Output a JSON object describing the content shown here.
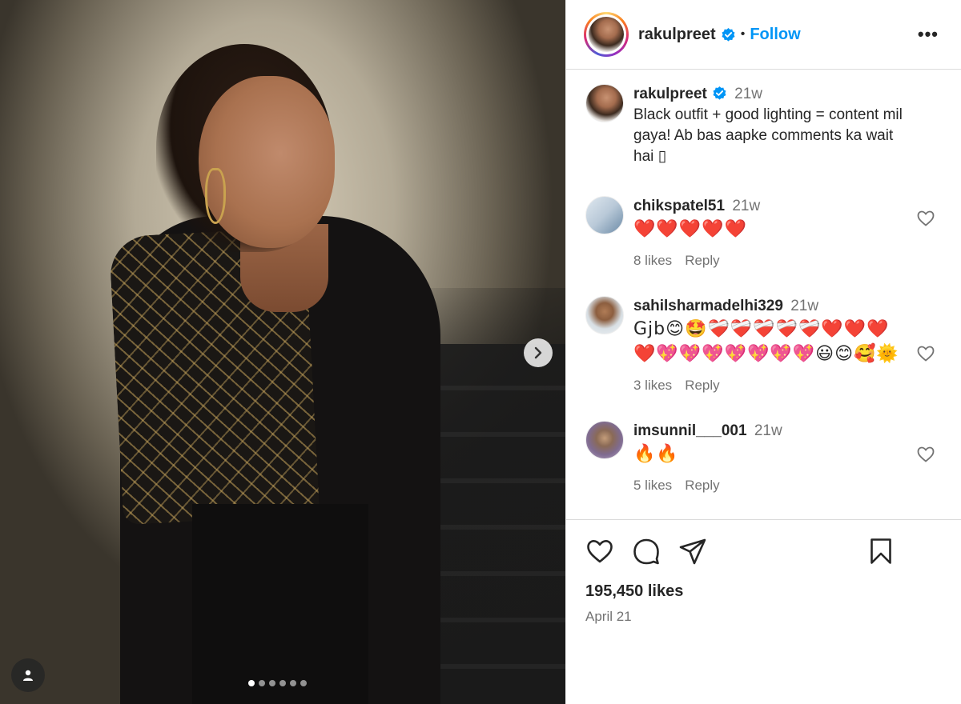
{
  "post": {
    "author": "rakulpreet",
    "follow_label": "Follow",
    "separator": "•",
    "more_label": "•••",
    "caption": {
      "author": "rakulpreet",
      "time": "21w",
      "text": "Black outfit + good lighting = content mil gaya! Ab bas aapke comments ka wait hai ▯"
    },
    "likes_text": "195,450 likes",
    "date": "April 21",
    "carousel": {
      "slide_count": 6,
      "active_index": 0
    }
  },
  "comments": [
    {
      "user": "chikspatel51",
      "time": "21w",
      "text": "❤️❤️❤️❤️❤️",
      "likes": "8 likes",
      "reply": "Reply"
    },
    {
      "user": "sahilsharmadelhi329",
      "time": "21w",
      "text": "Gjb😊🤩❤️‍🩹❤️‍🩹❤️‍🩹❤️‍🩹❤️‍🩹❤️❤️❤️❤️💖💖💖💖💖💖💖😃😊🥰🌞",
      "likes": "3 likes",
      "reply": "Reply"
    },
    {
      "user": "imsunnil___001",
      "time": "21w",
      "text": "🔥🔥",
      "likes": "5 likes",
      "reply": "Reply"
    }
  ],
  "colors": {
    "link": "#0095f6",
    "muted": "#737373",
    "text": "#262626",
    "verified": "#0095f6"
  }
}
